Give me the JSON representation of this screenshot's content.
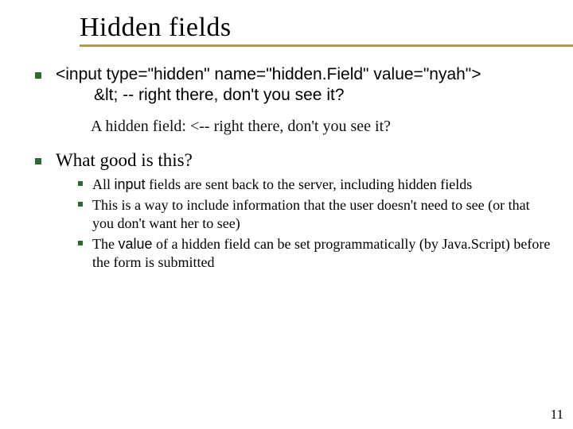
{
  "title": "Hidden fields",
  "bullets": {
    "code_line1": "<input type=\"hidden\" name=\"hidden.Field\" value=\"nyah\">",
    "code_line2": "&lt; -- right there, don't you see it?",
    "render_text": "A hidden field: <-- right there, don't you see it?",
    "question": "What good is this?",
    "subs": [
      {
        "pre": "All ",
        "code": "input",
        "post": " fields are sent back to the server, including hidden fields"
      },
      {
        "text": "This is a way to include information that the user doesn't need to see (or that you don't want her to see)"
      },
      {
        "pre": "The ",
        "code": "value",
        "post": " of a hidden field can be set programmatically (by Java.Script) before the form is submitted"
      }
    ]
  },
  "page_number": "11"
}
